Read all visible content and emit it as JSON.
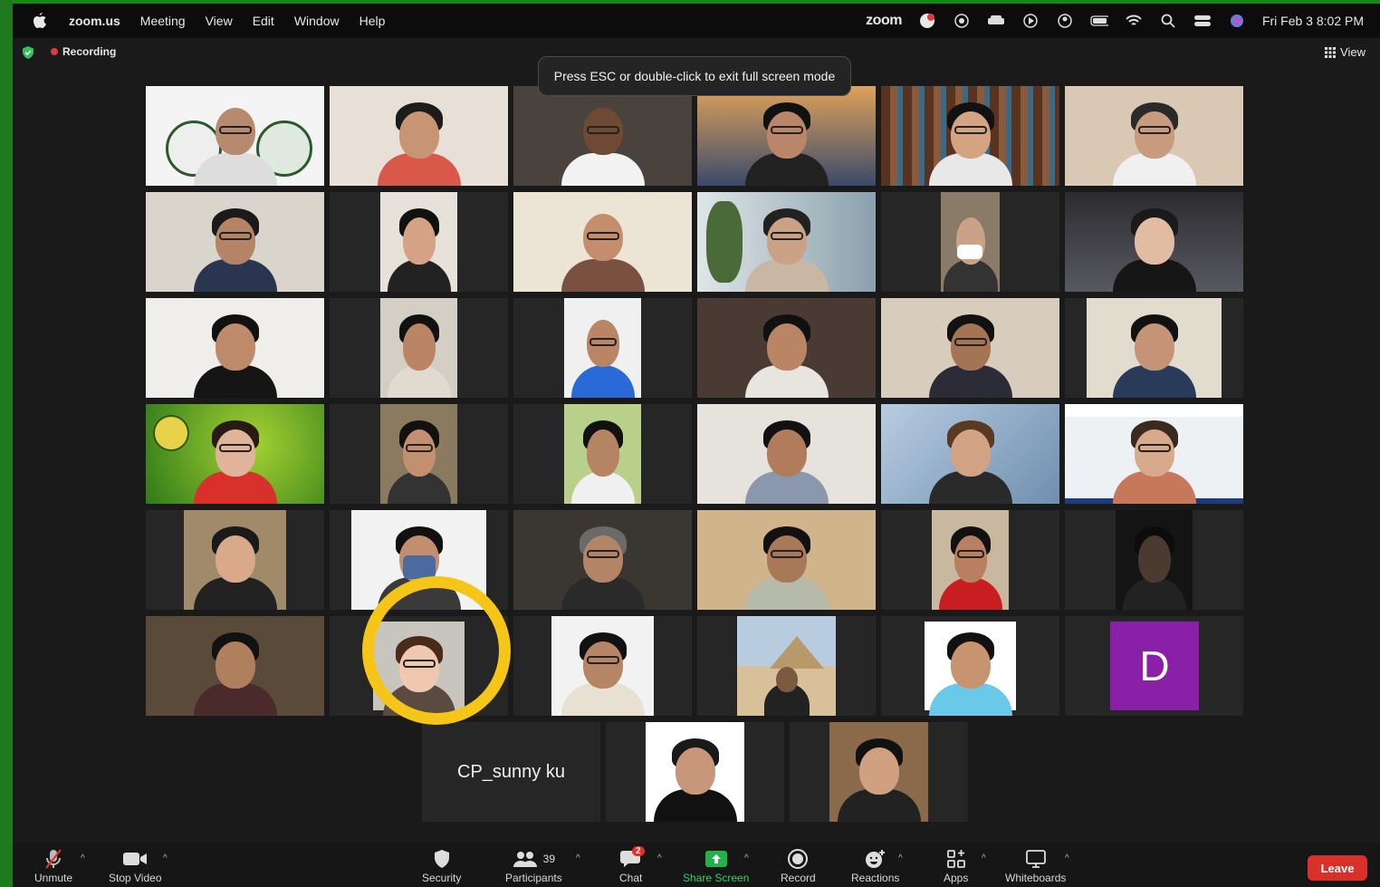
{
  "menubar": {
    "app_name": "zoom.us",
    "items": [
      "Meeting",
      "View",
      "Edit",
      "Window",
      "Help"
    ],
    "zoom_logo": "zoom",
    "datetime": "Fri Feb 3  8:02 PM"
  },
  "meeting": {
    "recording_label": "Recording",
    "view_label": "View",
    "fullscreen_toast": "Press ESC or double-click to exit full screen mode"
  },
  "participants_grid": {
    "avatar_letter": "D",
    "name_only_tile": "CP_sunny ku",
    "tile_bg_color": "#262626",
    "active_speaker_color": "#2fc259",
    "highlight_ring_color": "#f5c518"
  },
  "toolbar": {
    "unmute": "Unmute",
    "stop_video": "Stop Video",
    "security": "Security",
    "participants": "Participants",
    "participants_count": "39",
    "chat": "Chat",
    "chat_badge": "2",
    "share_screen": "Share Screen",
    "record": "Record",
    "reactions": "Reactions",
    "apps": "Apps",
    "whiteboards": "Whiteboards",
    "leave": "Leave",
    "share_color": "#21b24b",
    "leave_color": "#d9302a"
  }
}
